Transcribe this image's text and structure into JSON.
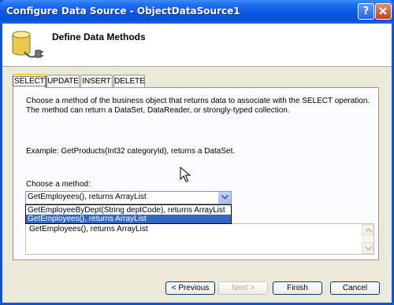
{
  "window": {
    "title": "Configure Data Source - ObjectDataSource1"
  },
  "header": {
    "title": "Define Data Methods",
    "icon": "database-plug-icon"
  },
  "tabs": [
    {
      "label": "SELECT",
      "active": true
    },
    {
      "label": "UPDATE",
      "active": false
    },
    {
      "label": "INSERT",
      "active": false
    },
    {
      "label": "DELETE",
      "active": false
    }
  ],
  "select_tab": {
    "description": "Choose a method of the business object that returns data to associate with the SELECT operation. The method can return a DataSet, DataReader, or strongly-typed collection.",
    "example": "Example: GetProducts(Int32 categoryId), returns a DataSet.",
    "choose_label": "Choose a method:",
    "method_value": "GetEmployees(), returns ArrayList",
    "dropdown_options": [
      "GetEmployeeByDept(String deptCode), returns ArrayList",
      "GetEmployees(), returns ArrayList"
    ],
    "selected_option": "GetEmployees(), returns ArrayList",
    "signature": "GetEmployees(), returns ArrayList"
  },
  "buttons": {
    "previous": "< Previous",
    "next": "Next >",
    "finish": "Finish",
    "cancel": "Cancel"
  },
  "colors": {
    "titlebar": "#0a58e4",
    "selection": "#316ac5",
    "dialog_bg": "#ece9d8"
  }
}
